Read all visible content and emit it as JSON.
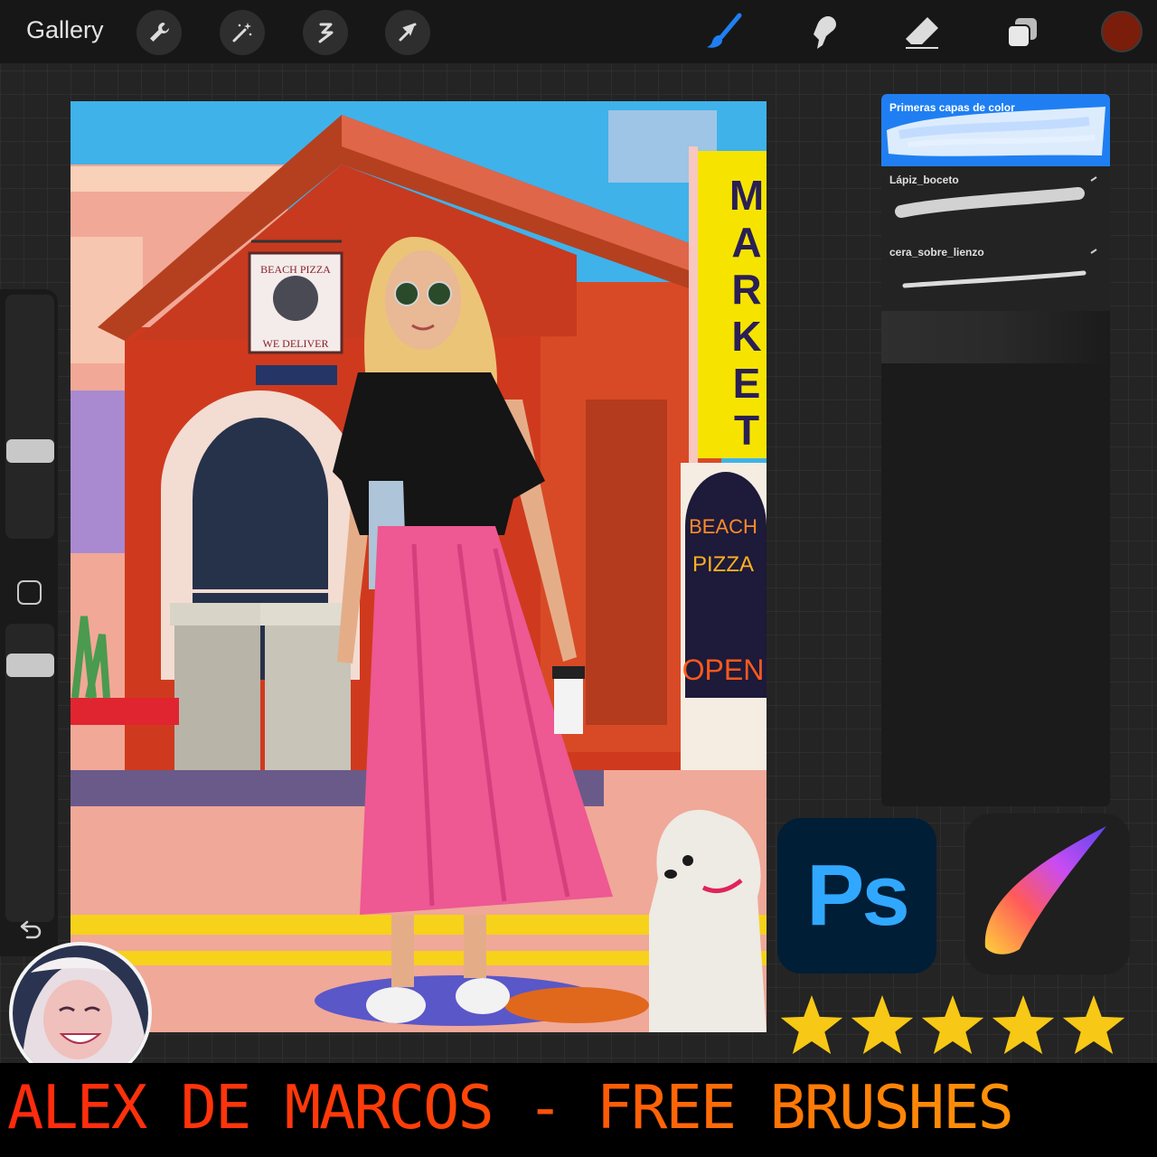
{
  "toolbar": {
    "gallery_label": "Gallery",
    "left_tools": [
      "wrench-icon",
      "magic-wand-icon",
      "selection-icon",
      "transform-arrow-icon"
    ],
    "right_tools": [
      "brush-icon",
      "smudge-icon",
      "eraser-icon",
      "layers-icon"
    ],
    "current_color": "#7a1d0a",
    "active_tool_color": "#1f7ff2"
  },
  "sidebar": {
    "controls": [
      "brush-size-slider",
      "modify-button",
      "opacity-slider",
      "undo-icon"
    ]
  },
  "brush_library": {
    "brushes": [
      {
        "name": "Primeras capas de color",
        "selected": true
      },
      {
        "name": "Lápiz_boceto",
        "selected": false
      },
      {
        "name": "cera_sobre_lienzo",
        "selected": false
      }
    ]
  },
  "canvas": {
    "sign_text": "BEACH PIZZA",
    "sign_subtext": "WE DELIVER",
    "market_letters": [
      "M",
      "A",
      "R",
      "K",
      "E",
      "T"
    ],
    "neon_line1": "BEACH",
    "neon_line2": "PIZZA",
    "neon_line3": "OPEN"
  },
  "badges": {
    "photoshop_label": "Ps",
    "star_count": 5,
    "star_color": "#f7c815"
  },
  "banner": {
    "text": "ALEX DE MARCOS - FREE BRUSHES"
  }
}
